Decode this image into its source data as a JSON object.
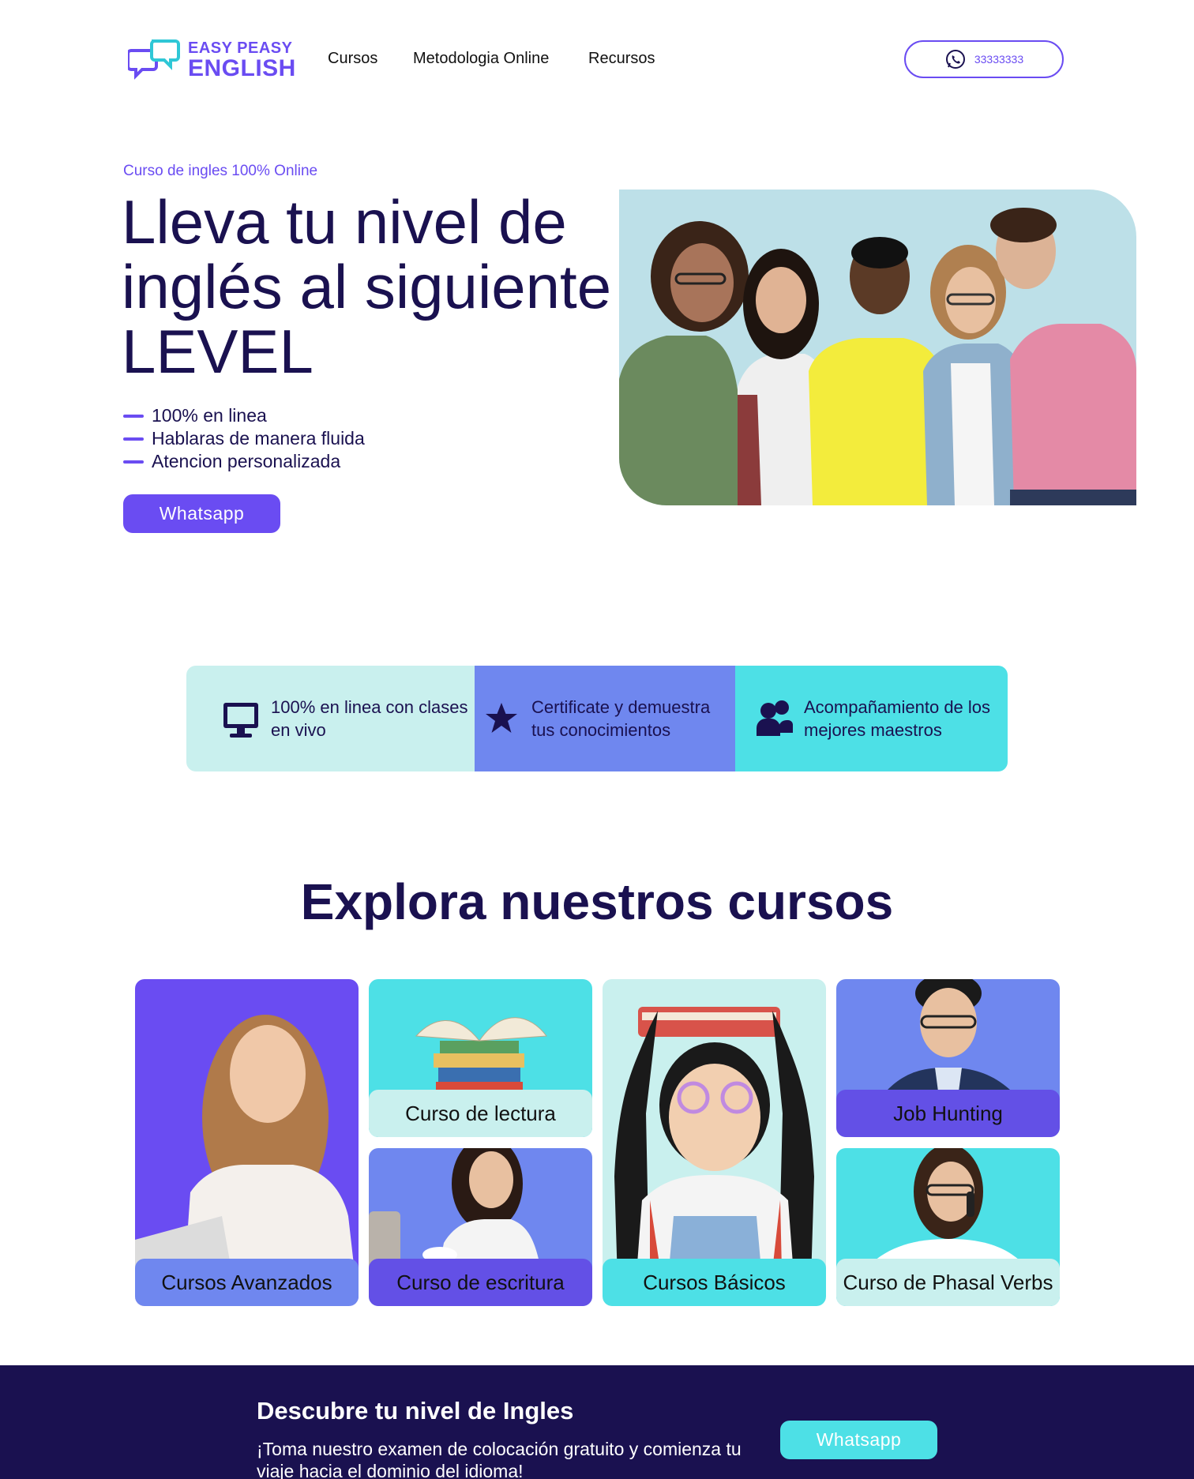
{
  "brand": {
    "line1": "EASY PEASY",
    "line2": "ENGLISH"
  },
  "nav": {
    "links": [
      "Cursos",
      "Metodologia Online",
      "Recursos"
    ],
    "phone": "33333333"
  },
  "hero": {
    "eyebrow": "Curso de ingles 100% Online",
    "title": "Lleva tu nivel de inglés al siguiente LEVEL",
    "bullets": [
      "100% en linea",
      "Hablaras de manera fluida",
      "Atencion personalizada"
    ],
    "cta": "Whatsapp"
  },
  "features": [
    {
      "icon": "monitor-icon",
      "text": "100% en linea con clases en vivo"
    },
    {
      "icon": "star-icon",
      "text": "Certificate y demuestra tus conocimientos"
    },
    {
      "icon": "people-icon",
      "text": "Acompañamiento de los mejores maestros"
    }
  ],
  "courses": {
    "title": "Explora nuestros cursos",
    "items": [
      {
        "label": "Cursos Avanzados"
      },
      {
        "label": "Curso de lectura"
      },
      {
        "label": "Curso de escritura"
      },
      {
        "label": "Cursos Básicos"
      },
      {
        "label": "Job Hunting"
      },
      {
        "label": "Curso de Phasal Verbs"
      }
    ]
  },
  "banner": {
    "title": "Descubre tu nivel de Ingles",
    "text": "¡Toma nuestro examen de colocación gratuito y comienza tu viaje hacia el dominio del idioma!",
    "cta": "Whatsapp"
  },
  "colors": {
    "accent": "#6a4cf2",
    "navy": "#1a1150",
    "cyan": "#4de0e6",
    "mint": "#c9f0ee",
    "periwinkle": "#6f87ef"
  }
}
